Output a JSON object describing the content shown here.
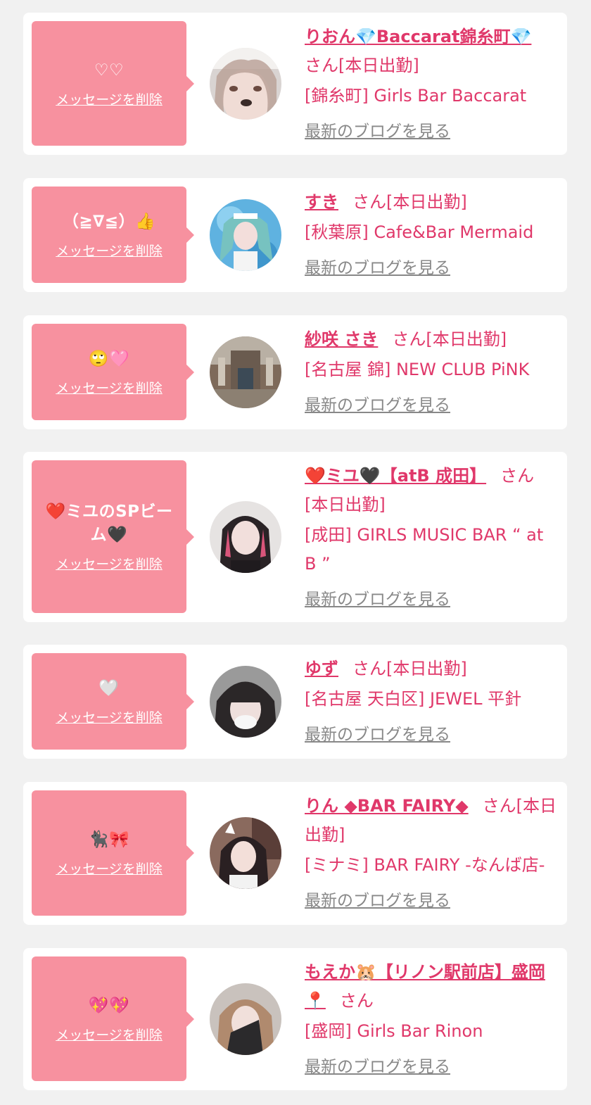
{
  "delete_label": "メッセージを削除",
  "blog_label": "最新のブログを見る",
  "colors": {
    "accent": "#e0386a",
    "bubble": "#f7919f",
    "background": "#f1f1f1",
    "card": "#ffffff",
    "link_gray": "#888888"
  },
  "entries": [
    {
      "message": "♡♡",
      "name": "りおん💎Baccarat錦糸町💎",
      "suffix": "さん[本日出勤]",
      "shop": "[錦糸町] Girls Bar Baccarat"
    },
    {
      "message": "（≧∇≦）👍",
      "name": "すき",
      "suffix": "さん[本日出勤]",
      "shop": "[秋葉原] Cafe&Bar Mermaid"
    },
    {
      "message": "🙄🩷",
      "name": "紗咲 さき",
      "suffix": "さん[本日出勤]",
      "shop": "[名古屋 錦] NEW CLUB PiNK"
    },
    {
      "message": "❤️ミユのSPビーム🖤",
      "name": "❤️ミユ🖤【atB 成田】",
      "suffix": "さん[本日出勤]",
      "shop": "[成田] GIRLS MUSIC BAR “ at B ”"
    },
    {
      "message": "🤍",
      "name": "ゆず",
      "suffix": "さん[本日出勤]",
      "shop": "[名古屋 天白区] JEWEL 平針"
    },
    {
      "message": "🐈‍⬛🎀",
      "name": "りん ◆BAR FAIRY◆",
      "suffix": "さん[本日出勤]",
      "shop": "[ミナミ] BAR FAIRY -なんば店-"
    },
    {
      "message": "💖💖",
      "name": "もえか🐹【リノン駅前店】盛岡📍",
      "suffix": "さん",
      "shop": "[盛岡] Girls Bar Rinon"
    }
  ]
}
